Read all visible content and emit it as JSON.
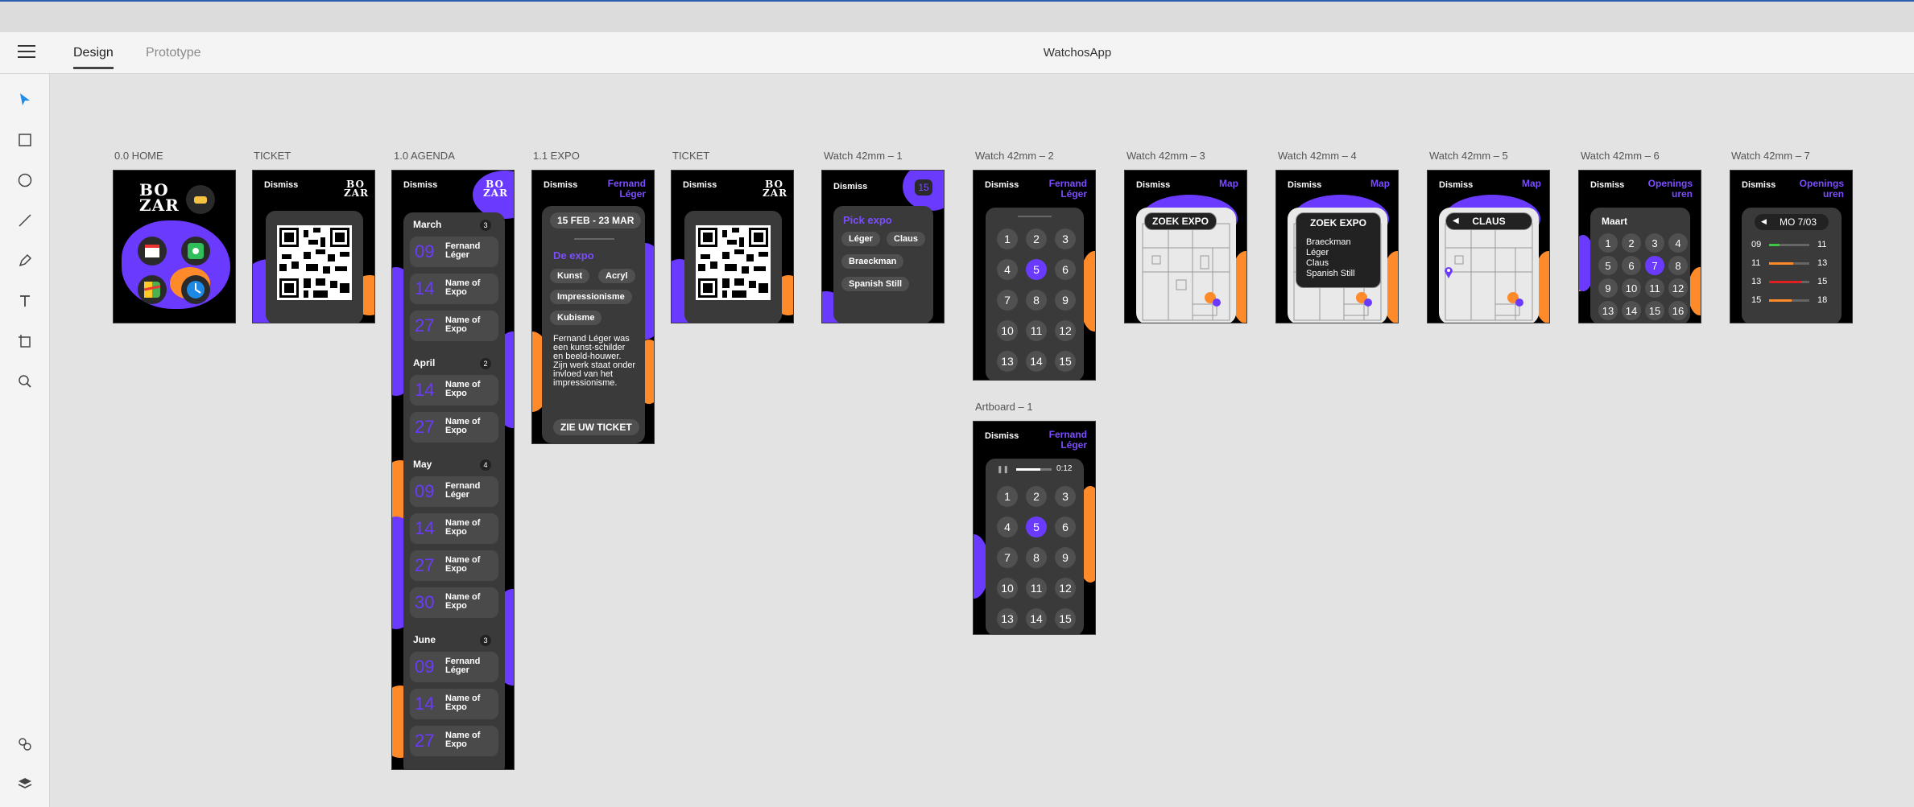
{
  "app": {
    "title": "WatchosApp",
    "tabs": [
      {
        "label": "Design"
      },
      {
        "label": "Prototype"
      }
    ]
  },
  "tools": [
    "select-tool",
    "rectangle-tool",
    "ellipse-tool",
    "line-tool",
    "pen-tool",
    "text-tool",
    "artboard-tool",
    "zoom-tool",
    "assets-icon",
    "layers-icon"
  ],
  "colors": {
    "accent": "#6a3aff",
    "board": "#000000",
    "panel": "#3a3a3a",
    "orange": "#ff8a2a"
  },
  "artboards": {
    "home": {
      "label": "0.0 HOME",
      "logo": "BO ZAR"
    },
    "ticket1": {
      "label": "TICKET",
      "dismiss": "Dismiss",
      "logo": "BO ZAR"
    },
    "agenda": {
      "label": "1.0 AGENDA",
      "dismiss": "Dismiss",
      "logo": "BO ZAR",
      "months": [
        {
          "name": "March",
          "count": "3",
          "items": [
            {
              "day": "09",
              "name": "Fernand Léger"
            },
            {
              "day": "14",
              "name": "Name of Expo"
            },
            {
              "day": "27",
              "name": "Name of Expo"
            }
          ]
        },
        {
          "name": "April",
          "count": "2",
          "items": [
            {
              "day": "14",
              "name": "Name of Expo"
            },
            {
              "day": "27",
              "name": "Name of Expo"
            }
          ]
        },
        {
          "name": "May",
          "count": "4",
          "items": [
            {
              "day": "09",
              "name": "Fernand Léger"
            },
            {
              "day": "14",
              "name": "Name of Expo"
            },
            {
              "day": "27",
              "name": "Name of Expo"
            },
            {
              "day": "30",
              "name": "Name of Expo"
            }
          ]
        },
        {
          "name": "June",
          "count": "3",
          "items": [
            {
              "day": "09",
              "name": "Fernand Léger"
            },
            {
              "day": "14",
              "name": "Name of Expo"
            },
            {
              "day": "27",
              "name": "Name of Expo"
            }
          ]
        }
      ]
    },
    "expo": {
      "label": "1.1 EXPO",
      "dismiss": "Dismiss",
      "title": "Fernand Léger",
      "dates": "15 FEB - 23 MAR",
      "section": "De expo",
      "tags": [
        "Kunst",
        "Acryl",
        "Impressionisme",
        "Kubisme"
      ],
      "desc": "Fernand Léger was een kunst-schilder en beeld-houwer. Zijn werk staat onder invloed van het impressionisme.",
      "cta": "ZIE UW TICKET"
    },
    "ticket2": {
      "label": "TICKET",
      "dismiss": "Dismiss",
      "logo": "BO ZAR"
    },
    "w1": {
      "label": "Watch 42mm – 1",
      "dismiss": "Dismiss",
      "badge": "15",
      "heading": "Pick expo",
      "options": [
        "Léger",
        "Claus",
        "Braeckman",
        "Spanish Still"
      ]
    },
    "w2": {
      "label": "Watch 42mm – 2",
      "dismiss": "Dismiss",
      "title": "Fernand Léger",
      "numbers": [
        "1",
        "2",
        "3",
        "4",
        "5",
        "6",
        "7",
        "8",
        "9",
        "10",
        "11",
        "12",
        "13",
        "14",
        "15"
      ],
      "selected": "5"
    },
    "artboard1": {
      "label": "Artboard – 1",
      "dismiss": "Dismiss",
      "title": "Fernand Léger",
      "time": "0:12",
      "numbers": [
        "1",
        "2",
        "3",
        "4",
        "5",
        "6",
        "7",
        "8",
        "9",
        "10",
        "11",
        "12",
        "13",
        "14",
        "15"
      ],
      "selected": "5"
    },
    "w3": {
      "label": "Watch 42mm – 3",
      "dismiss": "Dismiss",
      "title": "Map",
      "search": "ZOEK EXPO"
    },
    "w4": {
      "label": "Watch 42mm – 4",
      "dismiss": "Dismiss",
      "title": "Map",
      "search": "ZOEK EXPO",
      "results": [
        "Braeckman",
        "Léger",
        "Claus",
        "Spanish Still"
      ]
    },
    "w5": {
      "label": "Watch 42mm – 5",
      "dismiss": "Dismiss",
      "title": "Map",
      "search": "CLAUS"
    },
    "w6": {
      "label": "Watch 42mm – 6",
      "dismiss": "Dismiss",
      "title": "Openings uren",
      "month": "Maart",
      "days": [
        "1",
        "2",
        "3",
        "4",
        "5",
        "6",
        "7",
        "8",
        "9",
        "10",
        "11",
        "12",
        "13",
        "14",
        "15",
        "16"
      ],
      "selected": "7"
    },
    "w7": {
      "label": "Watch 42mm – 7",
      "dismiss": "Dismiss",
      "title": "Openings uren",
      "date": "MO 7/03",
      "hours": [
        {
          "from": "09",
          "to": "11",
          "fill": 0.25,
          "color": "#3cc83c"
        },
        {
          "from": "11",
          "to": "13",
          "fill": 0.6,
          "color": "#ff8a2a"
        },
        {
          "from": "13",
          "to": "15",
          "fill": 0.8,
          "color": "#e02020"
        },
        {
          "from": "15",
          "to": "18",
          "fill": 0.55,
          "color": "#ff8a2a"
        }
      ]
    }
  }
}
